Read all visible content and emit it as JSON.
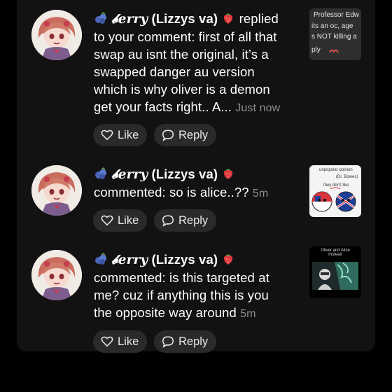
{
  "colors": {
    "background": "#000000",
    "panel": "#121212",
    "button": "#2a2a2a",
    "muted_text": "#8e8e8e"
  },
  "icons": {
    "avatar": "anime-character-avatar",
    "blueberry": "blueberries-emoji",
    "strawberry": "strawberry-emoji",
    "like": "heart-outline-icon",
    "reply": "speech-bubble-icon"
  },
  "notifications": [
    {
      "user_script": "𝓫erry",
      "user_name": "(Lizzys va)",
      "action": "replied",
      "line1": "to your comment: first of all that",
      "line2": "swap au isnt the original, it’s a",
      "line3": "swapped danger au version",
      "line4": "which is why oliver is a demon",
      "line5": "get your facts right.. A...",
      "time": "Just now",
      "like_label": "Like",
      "reply_label": "Reply",
      "thumb": {
        "line1": "Professor Edw",
        "line2": "its an oc, age",
        "line3": "s NOT killing a",
        "line4": "ply"
      }
    },
    {
      "user_script": "𝓫erry",
      "user_name": "(Lizzys va)",
      "line1": "commented: so is alice..??",
      "time": "5m",
      "like_label": "Like",
      "reply_label": "Reply",
      "thumb": {
        "line1": "unpopular opinion",
        "line2": "(Dr. Bowes)",
        "line3": "they don't like"
      }
    },
    {
      "user_script": "𝓫erry",
      "user_name": "(Lizzys va)",
      "line1": "commented: is this targeted at",
      "line2": "me? cuz if anything this is you",
      "line3": "the opposite way around",
      "time": "5m",
      "like_label": "Like",
      "reply_label": "Reply",
      "thumb": {
        "line1": "Oliver and Alice",
        "line2": "Instead"
      }
    }
  ]
}
